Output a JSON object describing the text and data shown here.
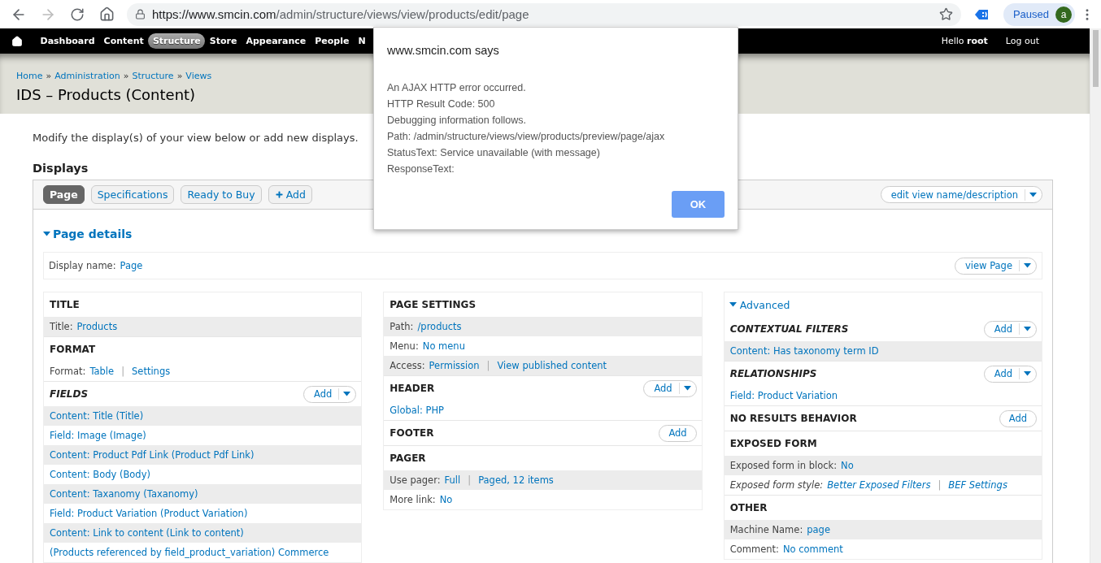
{
  "browser": {
    "url": {
      "host": "https://www.smcin.com",
      "path": "/admin/structure/views/view/products/edit/page"
    },
    "profile": {
      "label": "Paused",
      "avatar": "a"
    }
  },
  "toolbar": {
    "items": [
      {
        "label": "Dashboard",
        "selected": false
      },
      {
        "label": "Content",
        "selected": false
      },
      {
        "label": "Structure",
        "selected": true
      },
      {
        "label": "Store",
        "selected": false
      },
      {
        "label": "Appearance",
        "selected": false
      },
      {
        "label": "People",
        "selected": false
      },
      {
        "label": "N",
        "selected": false
      }
    ],
    "greeting": "Hello **root**",
    "logout": "Log out"
  },
  "breadcrumb": [
    {
      "text": "Home"
    },
    {
      "sep": "»",
      "text": "Administration"
    },
    {
      "sep": "»",
      "text": "Structure"
    },
    {
      "sep": "»",
      "text": "Views"
    }
  ],
  "title": "IDS – Products (Content)",
  "intro": "Modify the display(s) of your view below or add new displays.",
  "displays": {
    "heading": "Displays",
    "tabs": [
      {
        "label": "Page",
        "selected": true,
        "kind": "display"
      },
      {
        "label": "Specifications",
        "selected": false,
        "kind": "display"
      },
      {
        "label": "Ready to Buy",
        "selected": false,
        "kind": "display"
      },
      {
        "label": "Add",
        "selected": false,
        "kind": "add"
      }
    ],
    "edit_button": "edit view name/description"
  },
  "details": {
    "heading": "Page details",
    "expanded": true,
    "display_name_label": "Display name:",
    "display_name": "Page",
    "view_button": "view Page"
  },
  "columns": [
    {
      "sections": [
        {
          "title": "TITLE",
          "italic": false,
          "rows": [
            {
              "label": "Title:",
              "links": [
                "Products"
              ],
              "shaded": true,
              "italic": false
            }
          ]
        },
        {
          "title": "FORMAT",
          "italic": false,
          "rows": [
            {
              "label": "Format:",
              "links": [
                "Table",
                "Settings"
              ],
              "separator": "|",
              "shaded": false,
              "italic": false
            }
          ]
        },
        {
          "title": "FIELDS",
          "italic": true,
          "add": {
            "label": "Add",
            "dropdown": true
          },
          "rows": [
            {
              "links": [
                "Content: Title (Title)"
              ],
              "shaded": true,
              "italic": false
            },
            {
              "links": [
                "Field: Image (Image)"
              ],
              "shaded": false,
              "italic": false
            },
            {
              "links": [
                "Content: Product Pdf Link (Product Pdf Link)"
              ],
              "shaded": true,
              "italic": false
            },
            {
              "links": [
                "Content: Body (Body)"
              ],
              "shaded": false,
              "italic": false
            },
            {
              "links": [
                "Content: Taxanomy (Taxanomy)"
              ],
              "shaded": true,
              "italic": false
            },
            {
              "links": [
                "Field: Product Variation (Product Variation)"
              ],
              "shaded": false,
              "italic": false
            },
            {
              "links": [
                "Content: Link to content (Link to content)"
              ],
              "shaded": true,
              "italic": false
            },
            {
              "links": [
                "(Products referenced by field_product_variation) Commerce"
              ],
              "shaded": false,
              "italic": false
            }
          ]
        }
      ]
    },
    {
      "sections": [
        {
          "title": "PAGE SETTINGS",
          "italic": false,
          "rows": [
            {
              "label": "Path:",
              "links": [
                "/products"
              ],
              "shaded": true,
              "italic": false
            },
            {
              "label": "Menu:",
              "links": [
                "No menu"
              ],
              "shaded": false,
              "italic": false
            },
            {
              "label": "Access:",
              "links": [
                "Permission",
                "View published content"
              ],
              "separator": "|",
              "shaded": true,
              "italic": false
            }
          ]
        },
        {
          "title": "HEADER",
          "italic": false,
          "add": {
            "label": "Add",
            "dropdown": true
          },
          "rows": [
            {
              "links": [
                "Global: PHP"
              ],
              "shaded": false,
              "italic": false
            }
          ]
        },
        {
          "title": "FOOTER",
          "italic": false,
          "add": {
            "label": "Add",
            "dropdown": false
          }
        },
        {
          "title": "PAGER",
          "italic": false,
          "rows": [
            {
              "label": "Use pager:",
              "links": [
                "Full",
                "Paged, 12 items"
              ],
              "separator": "|",
              "shaded": true,
              "italic": false
            },
            {
              "label": "More link:",
              "links": [
                "No"
              ],
              "shaded": false,
              "italic": false
            }
          ]
        }
      ]
    },
    {
      "toggle": {
        "label": "Advanced",
        "expanded": true
      },
      "sections": [
        {
          "title": "CONTEXTUAL FILTERS",
          "italic": true,
          "add": {
            "label": "Add",
            "dropdown": true
          },
          "rows": [
            {
              "links": [
                "Content: Has taxonomy term ID"
              ],
              "shaded": true,
              "italic": false
            }
          ]
        },
        {
          "title": "RELATIONSHIPS",
          "italic": true,
          "add": {
            "label": "Add",
            "dropdown": true
          },
          "rows": [
            {
              "links": [
                "Field: Product Variation"
              ],
              "shaded": false,
              "italic": false
            }
          ]
        },
        {
          "title": "NO RESULTS BEHAVIOR",
          "italic": false,
          "add": {
            "label": "Add",
            "dropdown": false
          }
        },
        {
          "title": "EXPOSED FORM",
          "italic": false,
          "rows": [
            {
              "label": "Exposed form in block:",
              "links": [
                "No"
              ],
              "shaded": true,
              "italic": false
            },
            {
              "label": "Exposed form style:",
              "links": [
                "Better Exposed Filters",
                "BEF Settings"
              ],
              "separator": "|",
              "shaded": false,
              "italic": true
            }
          ]
        },
        {
          "title": "OTHER",
          "italic": false,
          "rows": [
            {
              "label": "Machine Name:",
              "links": [
                "page"
              ],
              "shaded": true,
              "italic": false
            },
            {
              "label": "Comment:",
              "links": [
                "No comment"
              ],
              "shaded": false,
              "italic": false
            }
          ]
        }
      ]
    }
  ],
  "dialog": {
    "origin": "www.smcin.com says",
    "lines": [
      "An AJAX HTTP error occurred.",
      "HTTP Result Code: 500",
      "Debugging information follows.",
      "Path: /admin/structure/views/view/products/preview/page/ajax",
      "StatusText: Service unavailable (with message)",
      "ResponseText:"
    ],
    "ok": "OK"
  }
}
